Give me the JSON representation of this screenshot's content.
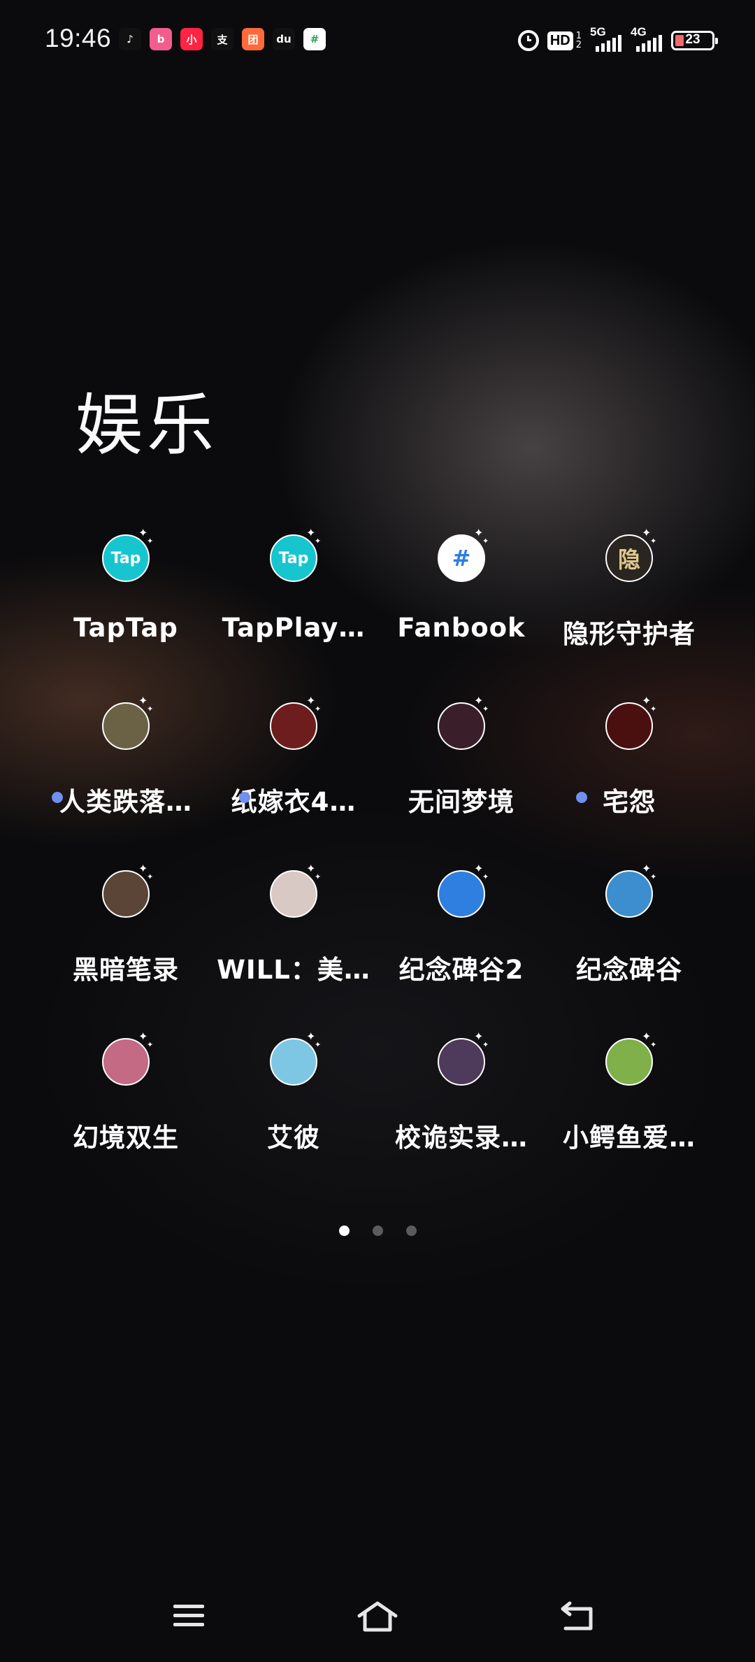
{
  "status_bar": {
    "time": "19:46",
    "notifications": [
      {
        "name": "tiktok-icon",
        "glyph": "♪",
        "bg": "#111111"
      },
      {
        "name": "bilibili-icon",
        "glyph": "b",
        "bg": "#f25d8e"
      },
      {
        "name": "xiaohongshu-icon",
        "glyph": "小",
        "bg": "#ff2442"
      },
      {
        "name": "alipay-icon",
        "glyph": "支",
        "bg": "#111111"
      },
      {
        "name": "meituan-icon",
        "glyph": "团",
        "bg": "#ff6a3c"
      },
      {
        "name": "baidu-icon",
        "glyph": "du",
        "bg": "#111111"
      },
      {
        "name": "fanbook-notif-icon",
        "glyph": "#",
        "bg": "#ffffff"
      }
    ],
    "hd_label": "HD",
    "hd_sub_top": "1",
    "hd_sub_bottom": "2",
    "net1": "5G",
    "net2": "4G",
    "battery_level": "23"
  },
  "folder": {
    "title": "娱乐"
  },
  "apps": [
    {
      "label": "TapTap",
      "icon": "taptap-icon",
      "bg": "#17c5cf",
      "glyph": "Tap",
      "dot": false
    },
    {
      "label": "TapPlay…",
      "icon": "tapplay-icon",
      "bg": "#17c5cf",
      "glyph": "Tap",
      "dot": false
    },
    {
      "label": "Fanbook",
      "icon": "fanbook-icon",
      "bg": "#ffffff",
      "glyph": "#",
      "dot": false
    },
    {
      "label": "隐形守护者",
      "icon": "yinxing-icon",
      "bg": "#2a2520",
      "glyph": "隐",
      "dot": false
    },
    {
      "label": "人类跌落…",
      "icon": "human-fall-flat-icon",
      "bg": "#6b6246",
      "glyph": "",
      "dot": true
    },
    {
      "label": "纸嫁衣4…",
      "icon": "zhijiayi-icon",
      "bg": "#6d1d1d",
      "glyph": "",
      "dot": true
    },
    {
      "label": "无间梦境",
      "icon": "wujian-icon",
      "bg": "#3a1f2a",
      "glyph": "",
      "dot": false
    },
    {
      "label": "宅怨",
      "icon": "zhaiyuan-icon",
      "bg": "#4a1010",
      "glyph": "",
      "dot": true
    },
    {
      "label": "黑暗笔录",
      "icon": "heian-icon",
      "bg": "#5a4537",
      "glyph": "",
      "dot": false
    },
    {
      "label": "WILL：美…",
      "icon": "will-icon",
      "bg": "#d9c9c4",
      "glyph": "",
      "dot": false
    },
    {
      "label": "纪念碑谷2",
      "icon": "monument-valley-2-icon",
      "bg": "#2e7fe0",
      "glyph": "",
      "dot": false
    },
    {
      "label": "纪念碑谷",
      "icon": "monument-valley-icon",
      "bg": "#3d8ecf",
      "glyph": "",
      "dot": false
    },
    {
      "label": "幻境双生",
      "icon": "huanjing-icon",
      "bg": "#c46a84",
      "glyph": "",
      "dot": false
    },
    {
      "label": "艾彼",
      "icon": "aibi-icon",
      "bg": "#7ec7e4",
      "glyph": "",
      "dot": false
    },
    {
      "label": "校诡实录…",
      "icon": "xiaogui-icon",
      "bg": "#4e3a5a",
      "glyph": "",
      "dot": false
    },
    {
      "label": "小鳄鱼爱…",
      "icon": "swampy-icon",
      "bg": "#7fb04a",
      "glyph": "",
      "dot": false
    }
  ],
  "pager": {
    "count": 3,
    "active": 0
  },
  "nav": {
    "menu_icon": "menu-icon",
    "home_icon": "home-icon",
    "back_icon": "back-icon"
  }
}
